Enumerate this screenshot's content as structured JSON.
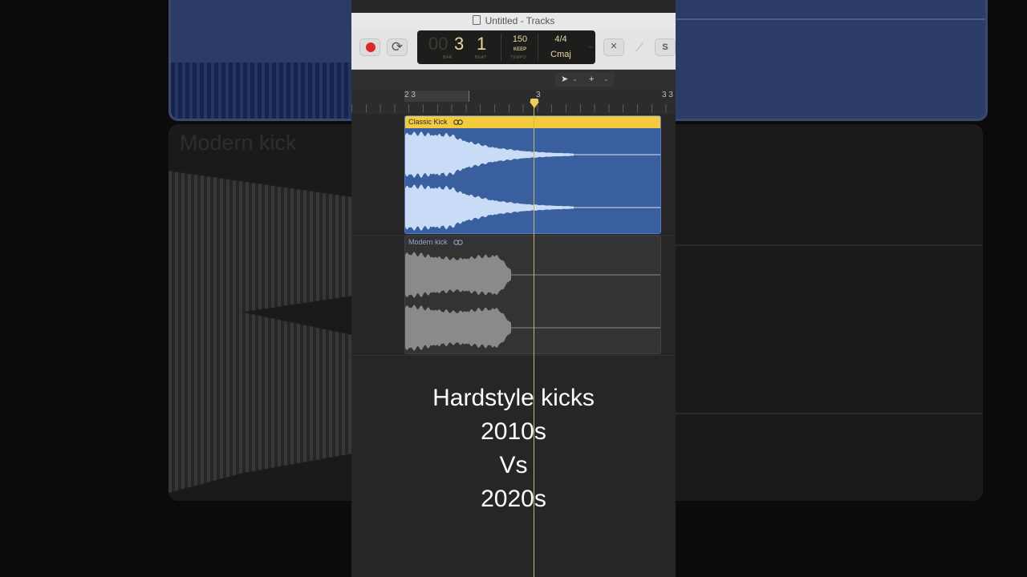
{
  "background": {
    "blurred_region_title": "Modern kick"
  },
  "window": {
    "title": "Untitled - Tracks"
  },
  "toolbar": {
    "lcd": {
      "bar": "3",
      "bar_ghost": "00",
      "beat": "1",
      "bar_label": "BAR",
      "beat_label": "BEAT",
      "tempo": "150",
      "tempo_mode": "KEEP",
      "tempo_label": "TEMPO",
      "time_signature": "4/4",
      "key": "Cmaj"
    }
  },
  "ruler": {
    "labels": [
      "2 3",
      "3",
      "3 3"
    ]
  },
  "regions": [
    {
      "name": "Classic Kick",
      "color": "#3a5f9f",
      "header_color": "#f3cb3d"
    },
    {
      "name": "Modern kick",
      "color": "#333333"
    }
  ],
  "caption": {
    "lines": [
      "Hardstyle kicks",
      "2010s",
      "Vs",
      "2020s"
    ]
  },
  "colors": {
    "accent_yellow": "#f3cb3d",
    "record_red": "#e0262a",
    "waveform_light": "#c9dcf7",
    "waveform_grey": "#8a8a8a"
  }
}
